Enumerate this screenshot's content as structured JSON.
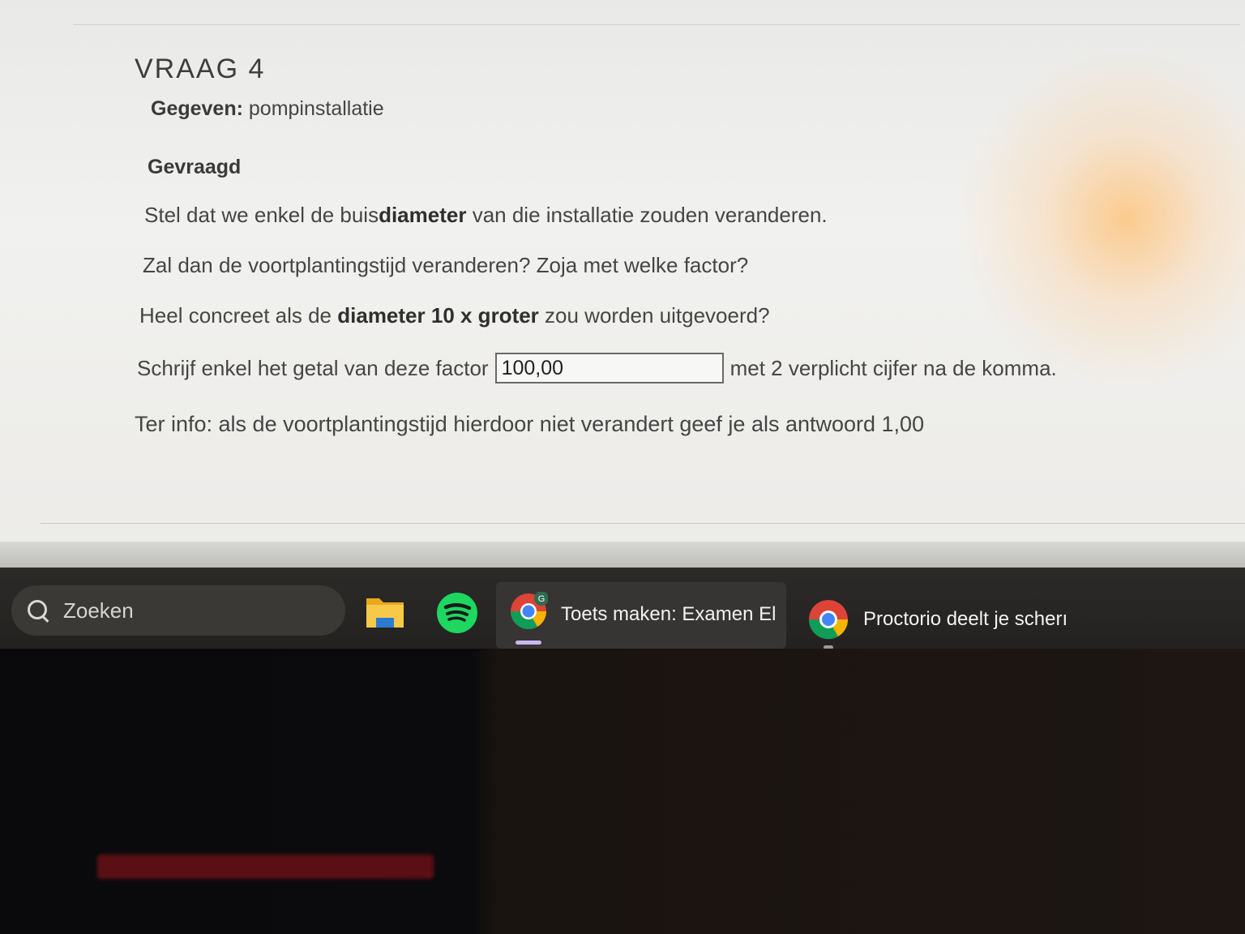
{
  "question": {
    "title": "VRAAG 4",
    "given_label": "Gegeven:",
    "given_value": " pompinstallatie",
    "asked": "Gevraagd",
    "p1_a": "Stel dat we enkel de buis",
    "p1_b": "diameter",
    "p1_c": " van die installatie zouden veranderen.",
    "p2": "Zal dan de voortplantingstijd veranderen? Zoja met welke factor?",
    "p3_a": "Heel concreet als de ",
    "p3_b": "diameter 10 x groter",
    "p3_c": " zou worden uitgevoerd?",
    "answer_prefix": "Schrijf enkel het getal van deze factor",
    "answer_value": "100,00",
    "answer_suffix": "met 2 verplicht cijfer na de komma.",
    "info": "Ter info: als de voortplantingstijd hierdoor niet verandert geef je als antwoord 1,00"
  },
  "taskbar": {
    "search_placeholder": "Zoeken",
    "icons": [
      "file-explorer-icon",
      "spotify-icon",
      "chrome-icon",
      "chrome-icon"
    ],
    "tasks": [
      {
        "label": "Toets maken: Examen El",
        "badge": "G",
        "active": true
      },
      {
        "label": "Proctorio deelt je scherı",
        "active": false
      }
    ]
  },
  "colors": {
    "page_bg": "#efefed",
    "text": "#454545",
    "taskbar_bg": "#2b2a28",
    "active_indicator": "#c9b7f0"
  }
}
